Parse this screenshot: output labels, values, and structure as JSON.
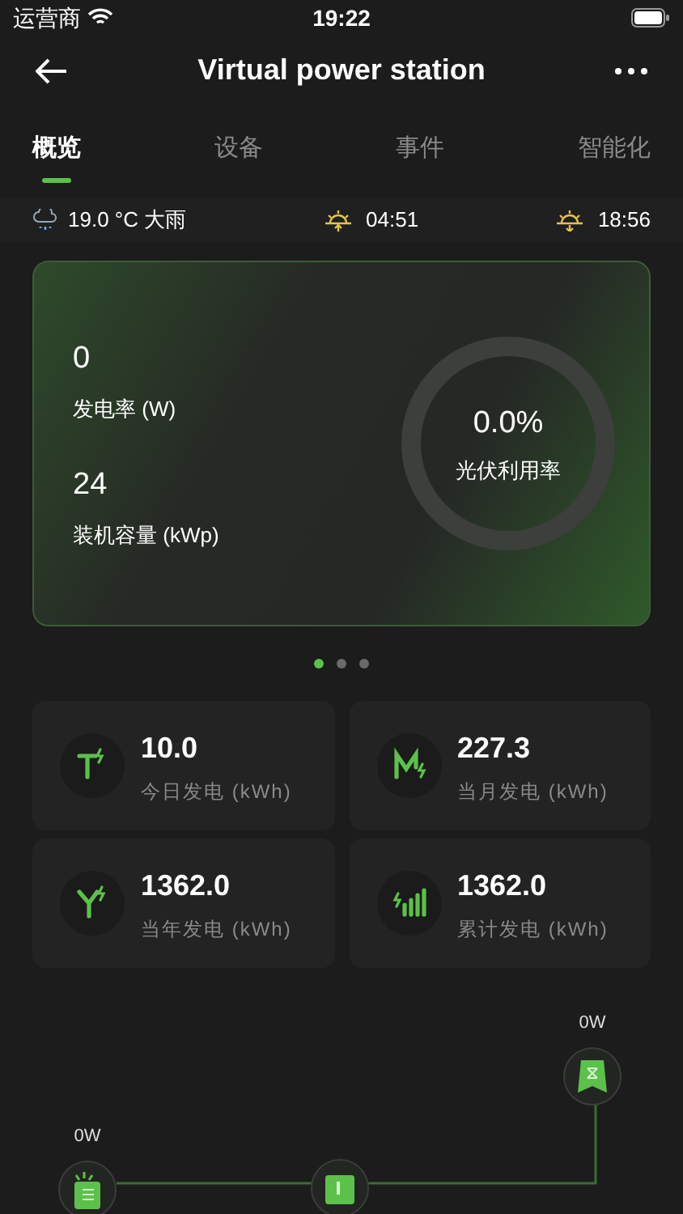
{
  "status_bar": {
    "carrier": "运营商",
    "time": "19:22"
  },
  "header": {
    "title": "Virtual power station"
  },
  "tabs": [
    {
      "label": "概览",
      "selected": true
    },
    {
      "label": "设备",
      "selected": false
    },
    {
      "label": "事件",
      "selected": false
    },
    {
      "label": "智能化",
      "selected": false
    }
  ],
  "weather": {
    "temperature": "19.0 °C 大雨",
    "sunrise": "04:51",
    "sunset": "18:56"
  },
  "overview": {
    "metrics": [
      {
        "value": "0",
        "label": "发电率 (W)"
      },
      {
        "value": "24",
        "label": "装机容量 (kWp)"
      }
    ],
    "gauge": {
      "value": "0.0%",
      "label": "光伏利用率"
    }
  },
  "pager": [
    {
      "selected": true
    },
    {
      "selected": false
    },
    {
      "selected": false
    }
  ],
  "stats": [
    {
      "kind": "day",
      "value": "10.0",
      "label": "今日发电 (kWh)"
    },
    {
      "kind": "month",
      "value": "227.3",
      "label": "当月发电 (kWh)"
    },
    {
      "kind": "year",
      "value": "1362.0",
      "label": "当年发电 (kWh)"
    },
    {
      "kind": "total",
      "value": "1362.0",
      "label": "累计发电 (kWh)"
    }
  ],
  "flow": {
    "nodes": [
      {
        "kind": "grid",
        "reading": "0W"
      },
      {
        "kind": "solar",
        "reading": "0W"
      },
      {
        "kind": "inverter"
      }
    ]
  }
}
